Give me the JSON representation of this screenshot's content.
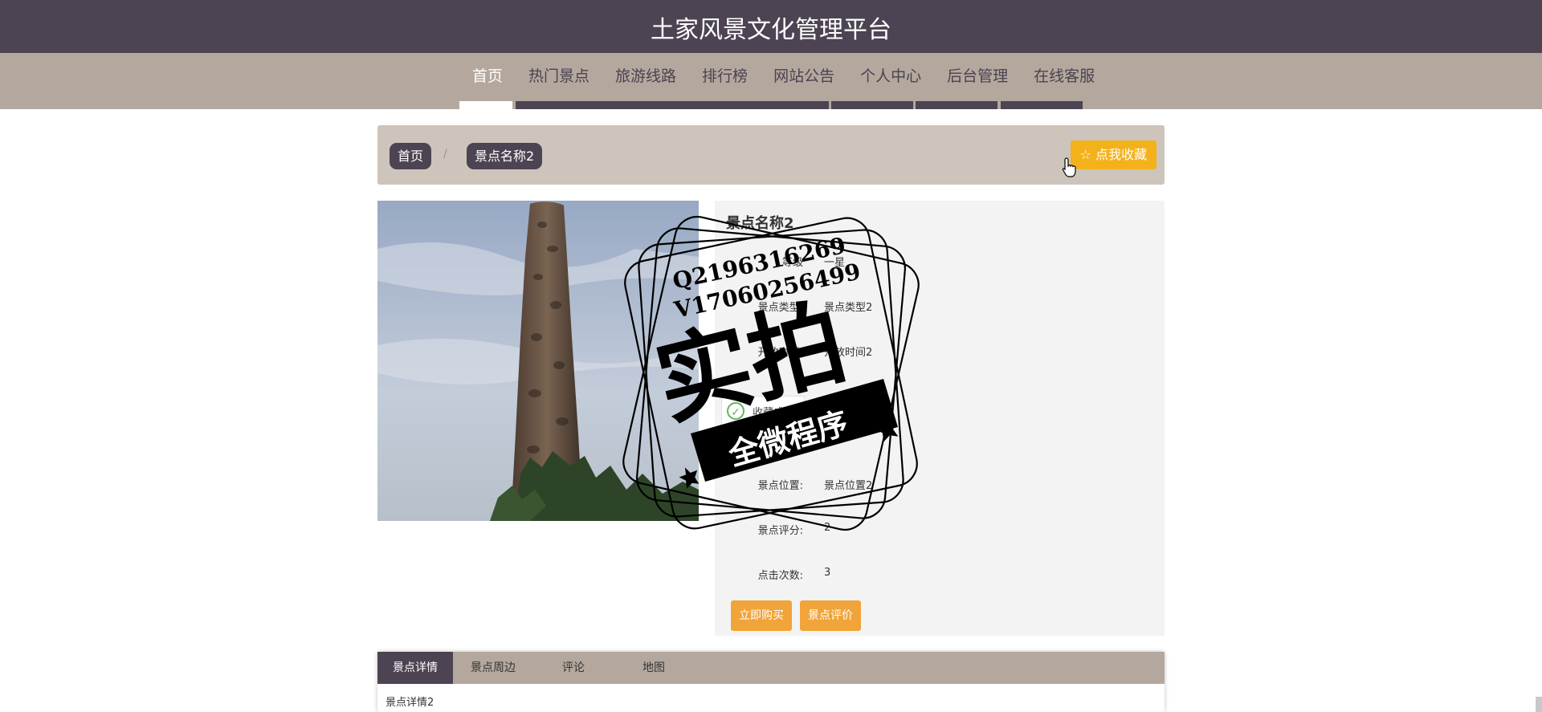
{
  "header": {
    "title": "土家风景文化管理平台"
  },
  "nav": {
    "items": [
      {
        "label": "首页",
        "active": true
      },
      {
        "label": "热门景点"
      },
      {
        "label": "旅游线路"
      },
      {
        "label": "排行榜"
      },
      {
        "label": "网站公告"
      },
      {
        "label": "个人中心"
      },
      {
        "label": "后台管理"
      },
      {
        "label": "在线客服"
      }
    ]
  },
  "breadcrumb": {
    "home": "首页",
    "separator": "/",
    "current": "景点名称2"
  },
  "favorite_button": {
    "icon": "star-outline-icon",
    "label": "点我收藏"
  },
  "detail": {
    "title": "景点名称2",
    "rows": [
      {
        "label": "等级",
        "value": "一星"
      },
      {
        "label": "景点类型:",
        "value": "景点类型2"
      },
      {
        "label": "开放时间:",
        "value": "开放时间2"
      },
      {
        "label": "景点位置:",
        "value": "景点位置2"
      },
      {
        "label": "景点评分:",
        "value": "2"
      },
      {
        "label": "点击次数:",
        "value": "3"
      }
    ],
    "toast": "收藏成功",
    "buy_button": "立即购买",
    "review_button": "景点评价"
  },
  "tabs": {
    "items": [
      {
        "label": "景点详情",
        "active": true
      },
      {
        "label": "景点周边"
      },
      {
        "label": "评论"
      },
      {
        "label": "地图"
      }
    ],
    "content": "景点详情2"
  },
  "watermark": {
    "contact_q": "Q2196316269",
    "contact_v": "V17060256499",
    "main": "实拍",
    "banner": "全微程序"
  },
  "colors": {
    "header": "#4c4452",
    "nav": "#b4a89e",
    "accent": "#f3b21b",
    "button": "#f0a43a"
  }
}
